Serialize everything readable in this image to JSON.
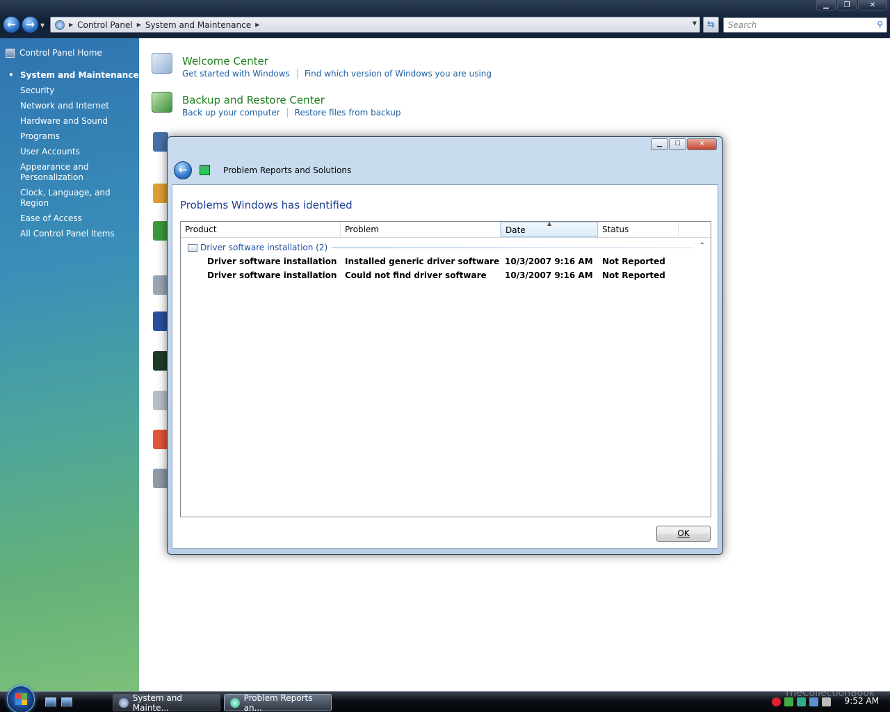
{
  "window": {
    "caption_buttons": [
      "minimize",
      "restore",
      "close"
    ]
  },
  "address": {
    "crumbs": [
      "Control Panel",
      "System and Maintenance"
    ]
  },
  "search": {
    "placeholder": "Search"
  },
  "sidebar": {
    "home": "Control Panel Home",
    "items": [
      {
        "label": "System and Maintenance",
        "active": true
      },
      {
        "label": "Security"
      },
      {
        "label": "Network and Internet"
      },
      {
        "label": "Hardware and Sound"
      },
      {
        "label": "Programs"
      },
      {
        "label": "User Accounts"
      },
      {
        "label": "Appearance and Personalization"
      },
      {
        "label": "Clock, Language, and Region"
      },
      {
        "label": "Ease of Access"
      },
      {
        "label": "All Control Panel Items"
      }
    ]
  },
  "tasks": [
    {
      "title": "Welcome Center",
      "links": [
        "Get started with Windows",
        "Find which version of Windows you are using"
      ]
    },
    {
      "title": "Backup and Restore Center",
      "links": [
        "Back up your computer",
        "Restore files from backup"
      ]
    }
  ],
  "dialog": {
    "title": "Problem Reports and Solutions",
    "heading": "Problems Windows has identified",
    "columns": [
      "Product",
      "Problem",
      "Date",
      "Status"
    ],
    "sorted_column": "Date",
    "group": {
      "label": "Driver software installation (2)"
    },
    "rows": [
      {
        "product": "Driver software installation",
        "problem": "Installed generic driver software",
        "date": "10/3/2007 9:16 AM",
        "status": "Not Reported"
      },
      {
        "product": "Driver software installation",
        "problem": "Could not find driver software",
        "date": "10/3/2007 9:16 AM",
        "status": "Not Reported"
      }
    ],
    "ok_label": "OK"
  },
  "taskbar": {
    "buttons": [
      {
        "label": "System and Mainte...",
        "active": false
      },
      {
        "label": "Problem Reports an...",
        "active": true
      }
    ],
    "clock": "9:52 AM",
    "watermark": "TheCollectionBook"
  },
  "colors": {
    "link": "#1a5fa6",
    "task_title": "#1e7f1e",
    "heading": "#1c3f8f"
  }
}
